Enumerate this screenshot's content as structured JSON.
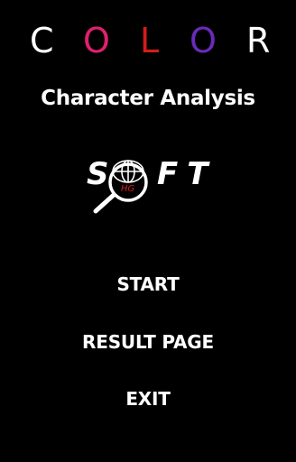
{
  "header": {
    "letters": [
      {
        "char": "C",
        "color": "#ffffff"
      },
      {
        "char": "O",
        "color": "#e0206e"
      },
      {
        "char": "L",
        "color": "#d41c1c"
      },
      {
        "char": "O",
        "color": "#6a2ab8"
      },
      {
        "char": "R",
        "color": "#ffffff"
      }
    ],
    "subtitle": "Character Analysis"
  },
  "logo": {
    "text_left": "S",
    "text_right": "FT",
    "badge": "HG",
    "badge_color": "#d41c1c",
    "icon": "magnifying-globe-icon"
  },
  "menu": {
    "start": "START",
    "result": "RESULT PAGE",
    "exit": "EXIT"
  }
}
